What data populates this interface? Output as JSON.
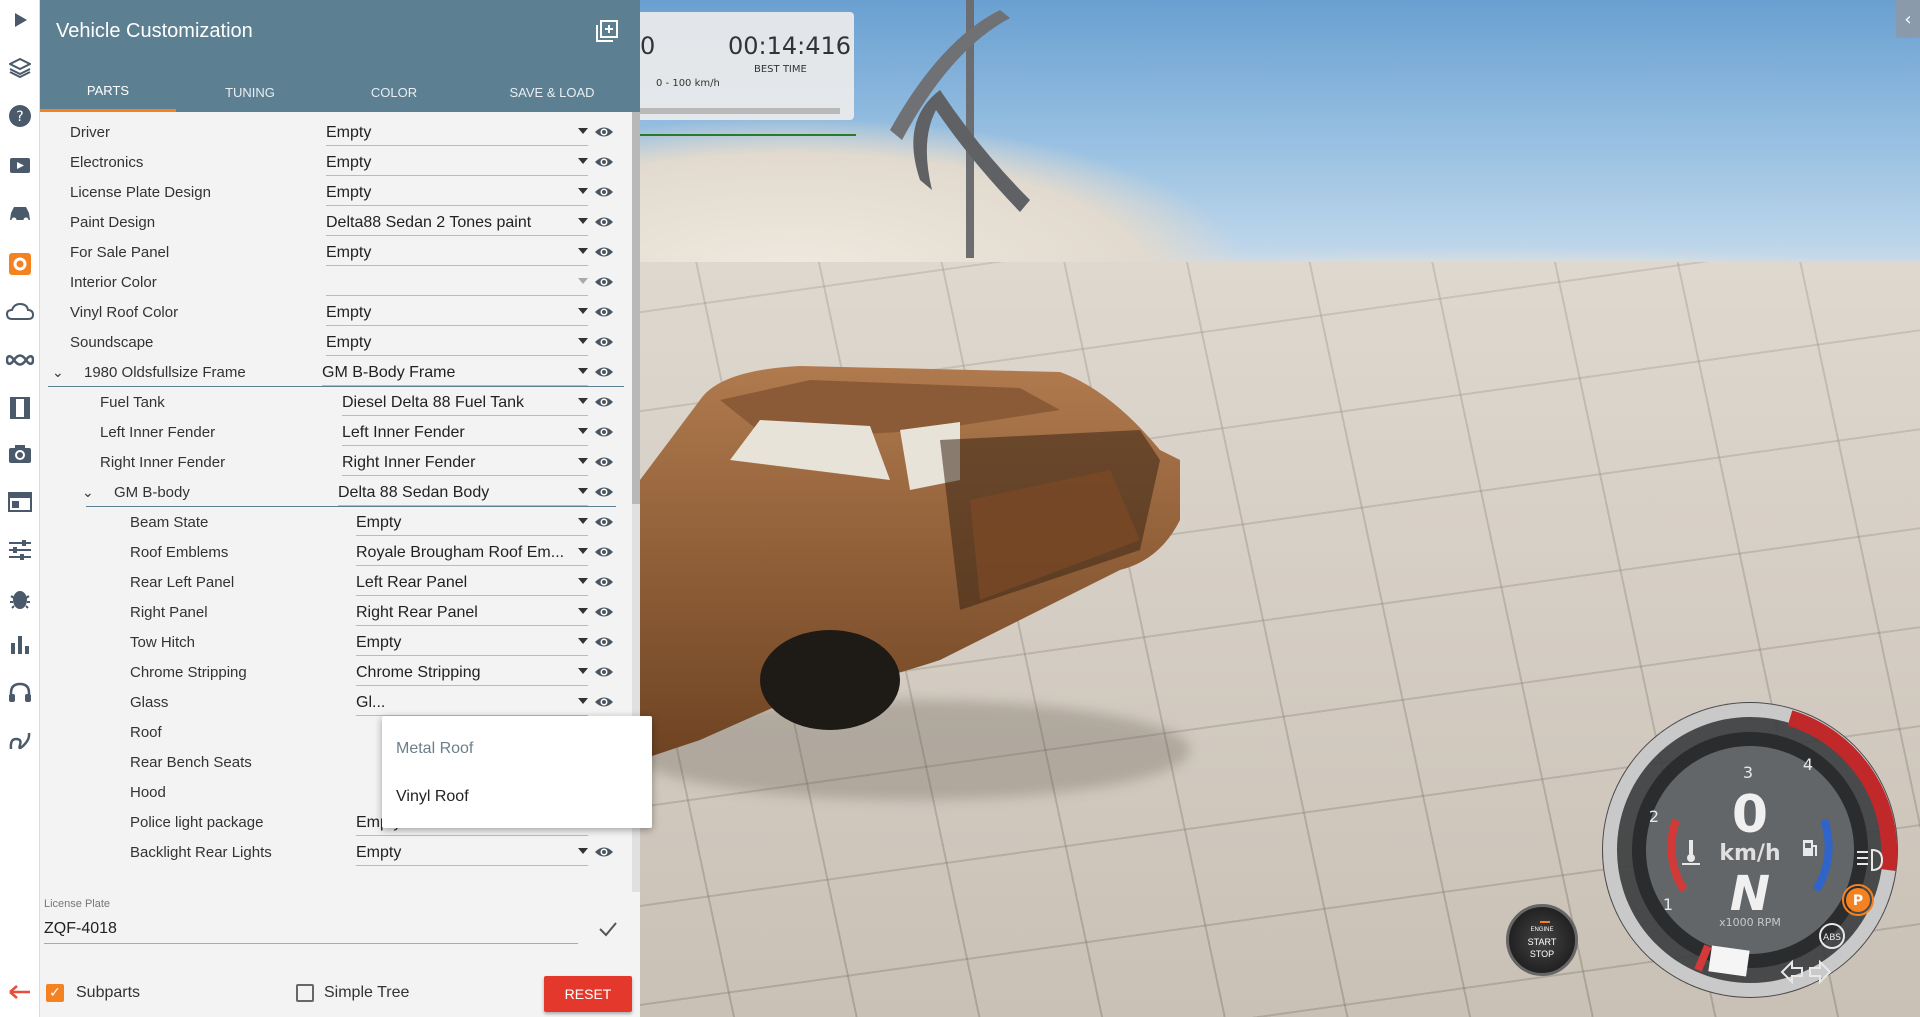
{
  "panel": {
    "title": "Vehicle Customization",
    "tabs": [
      {
        "label": "PARTS",
        "active": true
      },
      {
        "label": "TUNING",
        "active": false
      },
      {
        "label": "COLOR",
        "active": false
      },
      {
        "label": "SAVE & LOAD",
        "active": false
      }
    ]
  },
  "parts": [
    {
      "label": "Driver",
      "value": "Empty"
    },
    {
      "label": "Electronics",
      "value": "Empty"
    },
    {
      "label": "License Plate Design",
      "value": "Empty"
    },
    {
      "label": "Paint Design",
      "value": "Delta88 Sedan 2 Tones paint"
    },
    {
      "label": "For Sale Panel",
      "value": "Empty"
    },
    {
      "label": "Interior Color",
      "value": ""
    },
    {
      "label": "Vinyl Roof Color",
      "value": "Empty"
    },
    {
      "label": "Soundscape",
      "value": "Empty"
    },
    {
      "label": "1980 Oldsfullsize Frame",
      "value": "GM B-Body Frame"
    },
    {
      "label": "Fuel Tank",
      "value": "Diesel Delta 88 Fuel Tank"
    },
    {
      "label": "Left Inner Fender",
      "value": "Left Inner Fender"
    },
    {
      "label": "Right Inner Fender",
      "value": "Right Inner Fender"
    },
    {
      "label": "GM B-body",
      "value": "Delta 88 Sedan Body"
    },
    {
      "label": "Beam State",
      "value": "Empty"
    },
    {
      "label": "Roof Emblems",
      "value": "Royale Brougham Roof Em..."
    },
    {
      "label": "Rear Left Panel",
      "value": "Left Rear Panel"
    },
    {
      "label": "Right Panel",
      "value": "Right Rear Panel"
    },
    {
      "label": "Tow Hitch",
      "value": "Empty"
    },
    {
      "label": "Chrome Stripping",
      "value": "Chrome Stripping"
    },
    {
      "label": "Glass",
      "value": "Gl..."
    },
    {
      "label": "Roof",
      "value": ""
    },
    {
      "label": "Rear Bench Seats",
      "value": ""
    },
    {
      "label": "Hood",
      "value": ""
    },
    {
      "label": "Police light package",
      "value": "Empty"
    },
    {
      "label": "Backlight Rear Lights",
      "value": "Empty"
    }
  ],
  "dropdown": {
    "options": [
      "Metal Roof",
      "Vinyl Roof"
    ],
    "highlighted": "Metal Roof"
  },
  "license_plate": {
    "label": "License Plate",
    "value": "ZQF-4018"
  },
  "footer": {
    "subparts_label": "Subparts",
    "subparts_checked": true,
    "simple_tree_label": "Simple Tree",
    "simple_tree_checked": false,
    "reset_label": "RESET"
  },
  "timer": {
    "left_value": "0",
    "best_time": "00:14:416",
    "left_caption": "0 - 100 km/h",
    "best_caption": "BEST TIME"
  },
  "engine_button": {
    "line1": "ENGINE",
    "line2": "START",
    "line3": "STOP"
  },
  "gauge": {
    "speed": "0",
    "unit": "km/h",
    "gear": "N",
    "rpm_label": "x1000 RPM",
    "ticks": [
      "1",
      "2",
      "3",
      "4"
    ],
    "abs_label": "ABS",
    "parking_label": "P"
  },
  "colors": {
    "header": "#5c7f92",
    "accent": "#f58220",
    "reset": "#e5382c"
  }
}
